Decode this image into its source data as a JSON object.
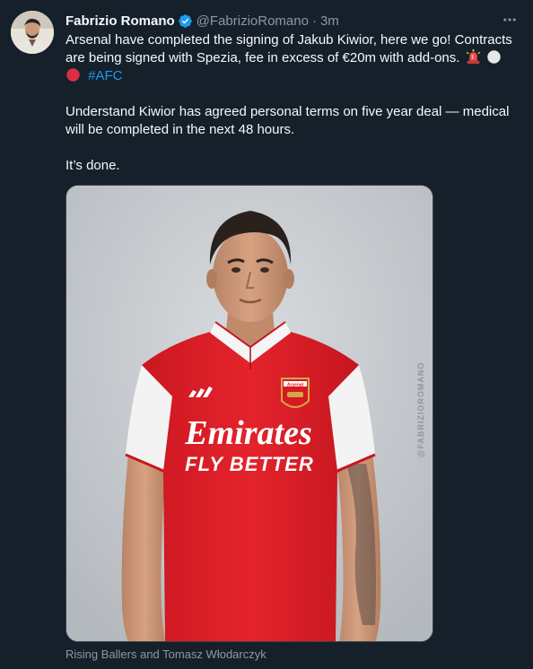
{
  "tweet": {
    "author": {
      "display_name": "Fabrizio Romano",
      "handle": "@FabrizioRomano",
      "separator": "·",
      "time": "3m",
      "verified": true,
      "avatar_icon": "avatar-photo"
    },
    "text": {
      "line1": "Arsenal have completed the signing of Jakub Kiwior, here we go! Contracts are being signed with Spezia, fee in excess of €20m with add-ons.",
      "hashtag": "#AFC",
      "paragraph2": "Understand Kiwior has agreed personal terms on five year deal — medical will be completed in the next 48 hours.",
      "paragraph3": "It’s done."
    },
    "emojis": [
      "siren-emoji",
      "white-circle-emoji",
      "red-circle-emoji"
    ],
    "media": {
      "shirt_sponsor": "Emirates",
      "shirt_slogan": "FLY BETTER",
      "crest_text": "Arsenal",
      "watermark": "@FABRIZIOROMANO",
      "colors": {
        "shirt_red": "#e0202b",
        "background": "#c9cdd1"
      }
    },
    "caption": "Rising Ballers and Tomasz Włodarczyk"
  },
  "theme": {
    "background": "#15202b",
    "text": "#f7f9f9",
    "muted": "#8b98a5",
    "link": "#1d9bf0"
  }
}
